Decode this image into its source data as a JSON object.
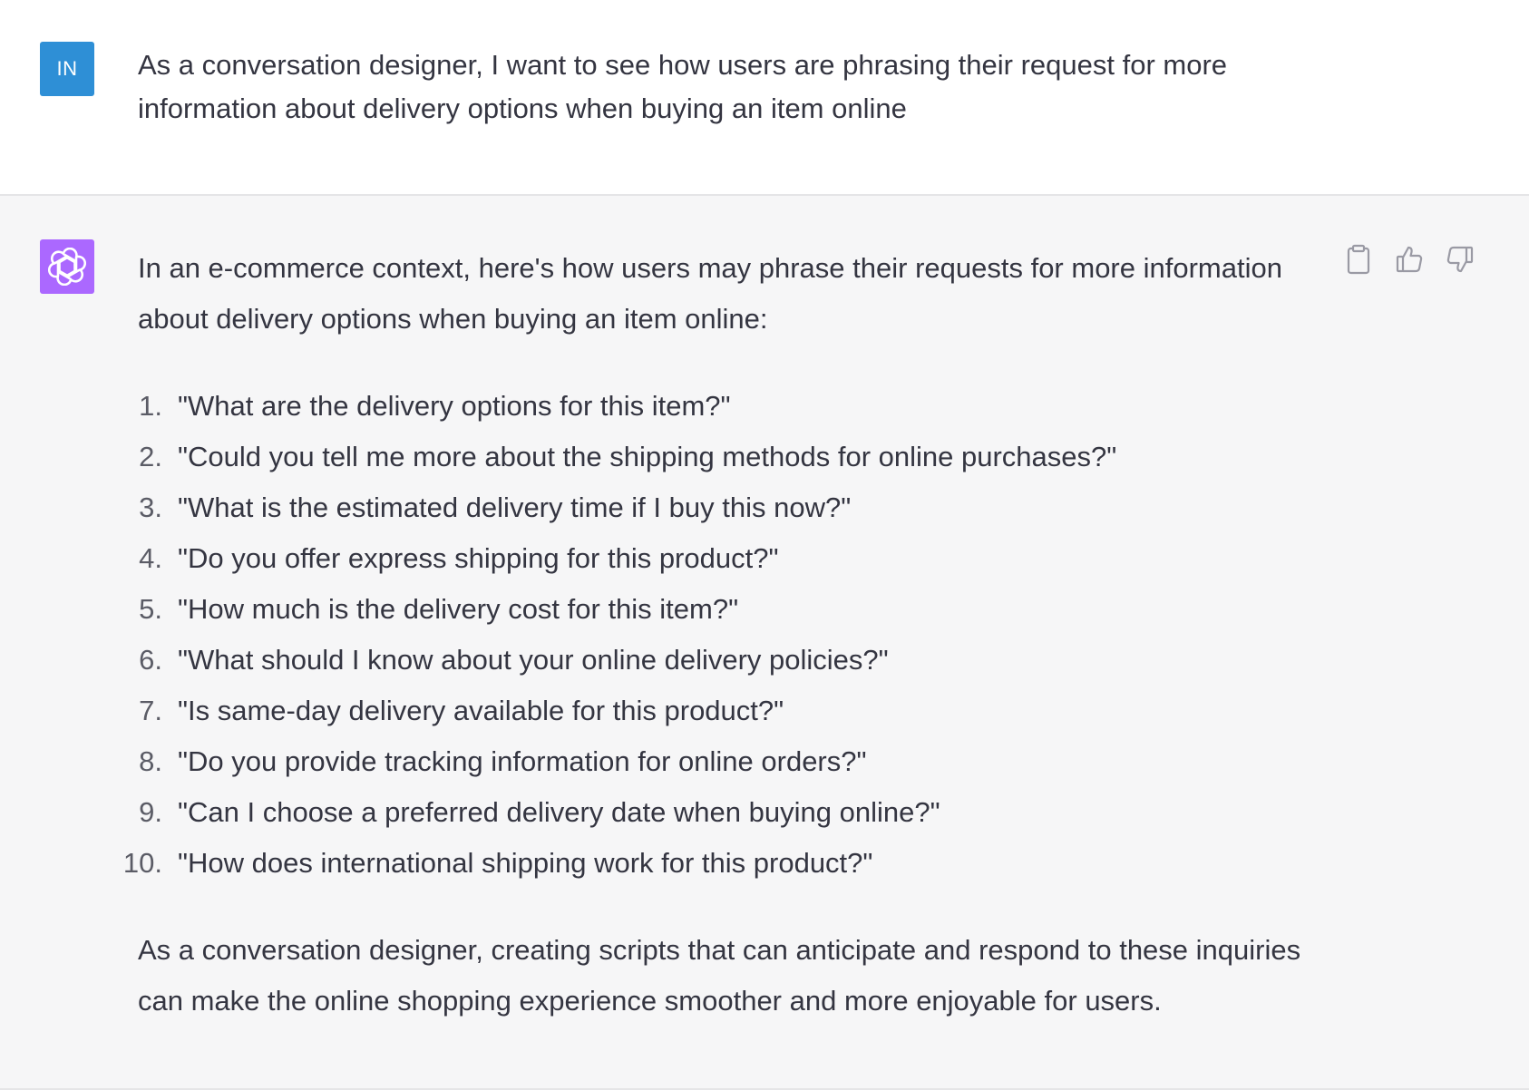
{
  "user_message": {
    "avatar_initials": "IN",
    "text": "As a conversation designer, I want to see how users are phrasing their request for more information about delivery options when buying an item online"
  },
  "assistant_message": {
    "intro": "In an e-commerce context, here's how users may phrase their requests for more information about delivery options when buying an item online:",
    "items": [
      {
        "num": "1.",
        "text": "\"What are the delivery options for this item?\""
      },
      {
        "num": "2.",
        "text": "\"Could you tell me more about the shipping methods for online purchases?\""
      },
      {
        "num": "3.",
        "text": "\"What is the estimated delivery time if I buy this now?\""
      },
      {
        "num": "4.",
        "text": "\"Do you offer express shipping for this product?\""
      },
      {
        "num": "5.",
        "text": "\"How much is the delivery cost for this item?\""
      },
      {
        "num": "6.",
        "text": "\"What should I know about your online delivery policies?\""
      },
      {
        "num": "7.",
        "text": "\"Is same-day delivery available for this product?\""
      },
      {
        "num": "8.",
        "text": "\"Do you provide tracking information for online orders?\""
      },
      {
        "num": "9.",
        "text": "\"Can I choose a preferred delivery date when buying online?\""
      },
      {
        "num": "10.",
        "text": "\"How does international shipping work for this product?\""
      }
    ],
    "outro": "As a conversation designer, creating scripts that can anticipate and respond to these inquiries can make the online shopping experience smoother and more enjoyable for users."
  },
  "actions": {
    "copy_icon": "clipboard-icon",
    "like_icon": "thumbs-up-icon",
    "dislike_icon": "thumbs-down-icon"
  },
  "colors": {
    "user_avatar": "#2e8fd6",
    "assistant_avatar": "#ab68ff",
    "assistant_bg": "#f6f6f7",
    "text": "#343541"
  }
}
